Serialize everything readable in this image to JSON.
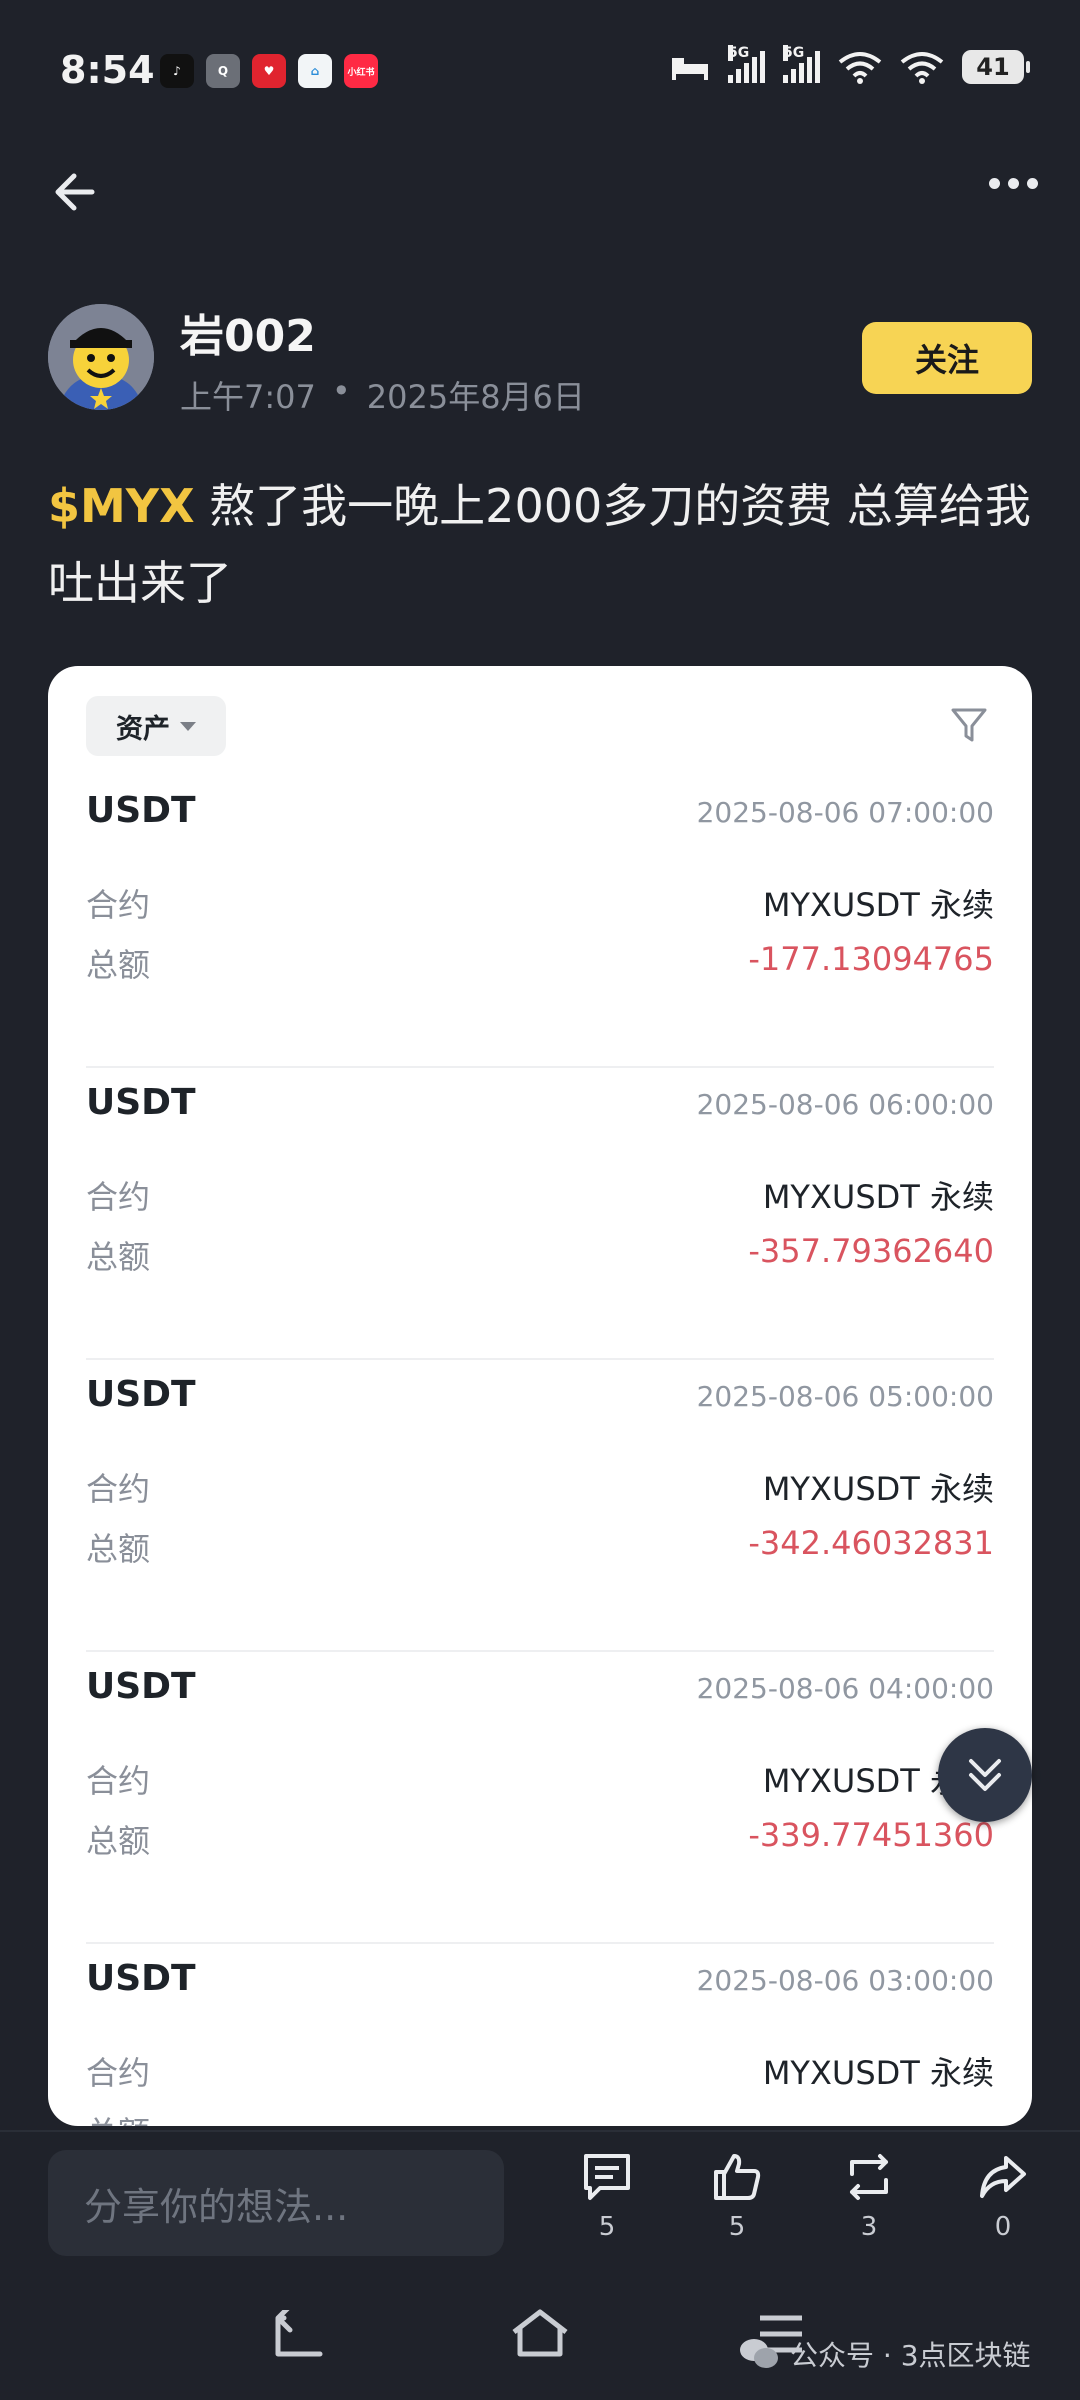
{
  "status_bar": {
    "time": "8:54",
    "network_1": "5G",
    "network_2": "5G",
    "battery": "41"
  },
  "author": {
    "name": "岩002",
    "time": "上午7:07",
    "date": "2025年8月6日",
    "follow_label": "关注"
  },
  "post": {
    "ticker": "$MYX",
    "text": " 熬了我一晚上2000多刀的资费 总算给我吐出来了"
  },
  "card": {
    "filter_label": "资产",
    "records": [
      {
        "currency": "USDT",
        "time": "2025-08-06 07:00:00",
        "contract_label": "合约",
        "contract": "MYXUSDT 永续",
        "amount_label": "总额",
        "amount": "-177.13094765"
      },
      {
        "currency": "USDT",
        "time": "2025-08-06 06:00:00",
        "contract_label": "合约",
        "contract": "MYXUSDT 永续",
        "amount_label": "总额",
        "amount": "-357.79362640"
      },
      {
        "currency": "USDT",
        "time": "2025-08-06 05:00:00",
        "contract_label": "合约",
        "contract": "MYXUSDT 永续",
        "amount_label": "总额",
        "amount": "-342.46032831"
      },
      {
        "currency": "USDT",
        "time": "2025-08-06 04:00:00",
        "contract_label": "合约",
        "contract": "MYXUSDT 永续",
        "amount_label": "总额",
        "amount": "-339.77451360"
      },
      {
        "currency": "USDT",
        "time": "2025-08-06 03:00:00",
        "contract_label": "合约",
        "contract": "MYXUSDT 永续",
        "amount_label": "总额",
        "amount": ""
      }
    ]
  },
  "bottom": {
    "input_placeholder": "分享你的想法...",
    "comments": "5",
    "likes": "5",
    "reposts": "3",
    "shares": "0"
  },
  "watermark": "公众号 · 3点区块链",
  "colors": {
    "background": "#1f222a",
    "accent": "#f7d454",
    "ticker": "#f2c541",
    "negative": "#d9545f"
  }
}
